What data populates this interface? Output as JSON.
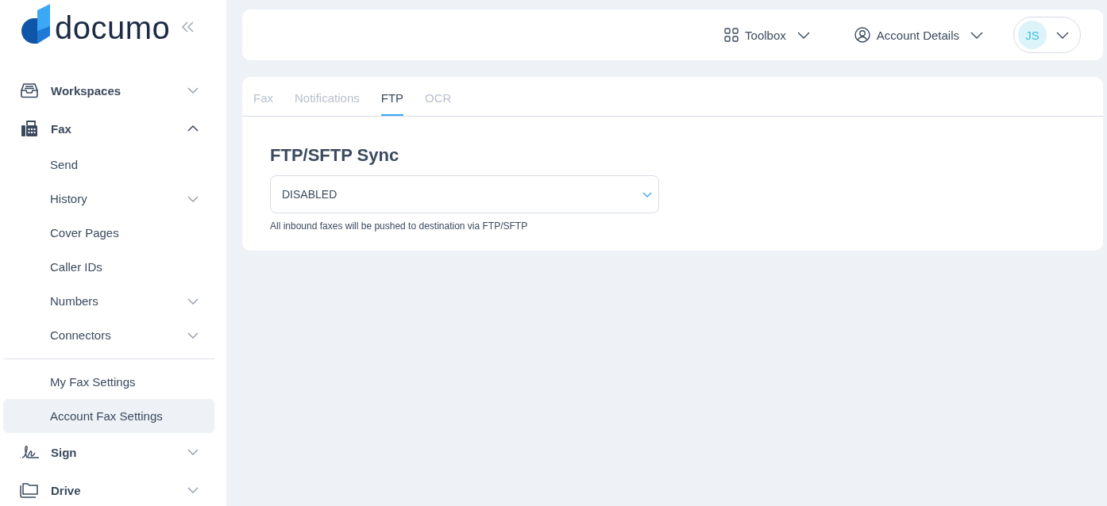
{
  "sidebar": {
    "logo_text": "documo",
    "nav": [
      {
        "label": "Workspaces",
        "kind": "inbox",
        "expanded": false
      },
      {
        "label": "Fax",
        "kind": "fax",
        "expanded": true,
        "children": [
          {
            "label": "Send",
            "kind": "link",
            "selected": false
          },
          {
            "label": "History",
            "kind": "group",
            "selected": false
          },
          {
            "label": "Cover Pages",
            "kind": "link",
            "selected": false
          },
          {
            "label": "Caller IDs",
            "kind": "link",
            "selected": false
          },
          {
            "label": "Numbers",
            "kind": "group",
            "selected": false
          },
          {
            "label": "Connectors",
            "kind": "group",
            "selected": false
          }
        ],
        "settings": [
          {
            "label": "My Fax Settings",
            "selected": false
          },
          {
            "label": "Account Fax Settings",
            "selected": true
          }
        ]
      },
      {
        "label": "Sign",
        "kind": "signature",
        "expanded": false
      },
      {
        "label": "Drive",
        "kind": "folder",
        "expanded": false
      }
    ]
  },
  "header": {
    "toolbox": "Toolbox",
    "account": "Account Details",
    "avatar": "JS"
  },
  "tabs": [
    {
      "label": "Fax",
      "selected": false
    },
    {
      "label": "Notifications",
      "selected": false
    },
    {
      "label": "FTP",
      "selected": true
    },
    {
      "label": "OCR",
      "selected": false
    }
  ],
  "section": {
    "title": "FTP/SFTP Sync",
    "select_value": "DISABLED",
    "help": "All inbound faxes will be pushed to destination via FTP/SFTP"
  }
}
